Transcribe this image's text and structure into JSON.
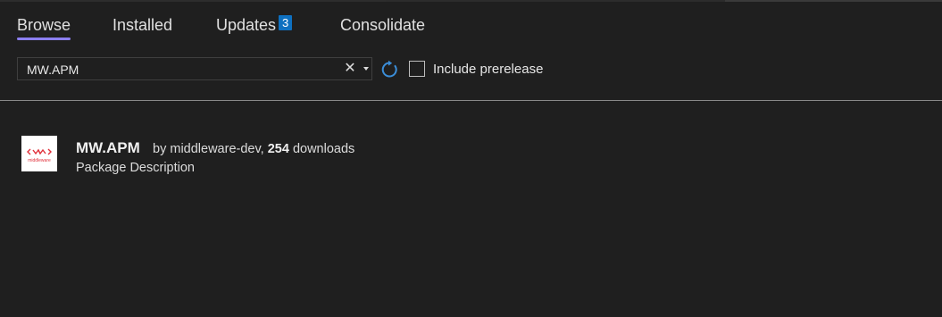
{
  "tabs": [
    {
      "label": "Browse",
      "active": true
    },
    {
      "label": "Installed",
      "active": false
    },
    {
      "label": "Updates",
      "active": false,
      "badge": "3"
    },
    {
      "label": "Consolidate",
      "active": false
    }
  ],
  "search": {
    "value": "MW.APM",
    "clear_icon": "close-icon",
    "dropdown_icon": "caret-down-icon"
  },
  "refresh_icon": "refresh-icon",
  "prerelease": {
    "label": "Include prerelease",
    "checked": false
  },
  "package": {
    "name": "MW.APM",
    "by_prefix": "by",
    "author": "middleware-dev,",
    "downloads": "254",
    "downloads_suffix": "downloads",
    "description": "Package Description",
    "logo_text": "middleware"
  },
  "colors": {
    "background": "#1f1f1f",
    "active_tab_underline": "#8c7ff0",
    "badge": "#0e70c0",
    "refresh": "#3b8ed9",
    "logo_accent": "#e0303a"
  }
}
